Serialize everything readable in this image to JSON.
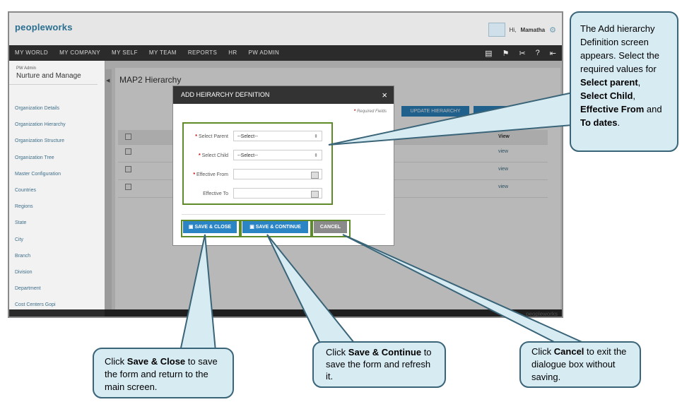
{
  "app": {
    "logo": "peopleworks",
    "user_greeting": "Hi,",
    "user_name": "Mamatha"
  },
  "nav": {
    "items": [
      "MY WORLD",
      "MY COMPANY",
      "MY SELF",
      "MY TEAM",
      "REPORTS",
      "HR",
      "PW ADMIN"
    ],
    "icons": [
      "book-icon",
      "flag-icon",
      "tools-icon",
      "help-icon",
      "exit-icon"
    ]
  },
  "sidebar": {
    "section_small": "PW Admin",
    "section_title": "Nurture and Manage",
    "items": [
      "Organization Details",
      "Organization Hierarchy",
      "Organization Structure",
      "Organization Tree",
      "Master Configuration",
      "Countries",
      "Regions",
      "State",
      "City",
      "Branch",
      "Division",
      "Department",
      "Cost Centers Gopi"
    ]
  },
  "main": {
    "page_title": "MAP2 Hierarchy",
    "update_button": "UPDATE HIERARCHY",
    "table": {
      "header_view": "View",
      "rows": [
        {
          "view": "view"
        },
        {
          "view": "view"
        },
        {
          "view": "view"
        }
      ]
    }
  },
  "footer": {
    "brand": "peopleworks"
  },
  "modal": {
    "title": "ADD HEIRARCHY DEFNITION",
    "close": "×",
    "required_note": "Required Fields",
    "required_mark": "*",
    "fields": {
      "select_parent": {
        "label": "Select Parent",
        "value": "--Select--"
      },
      "select_child": {
        "label": "Select Child",
        "value": "--Select--"
      },
      "effective_from": {
        "label": "Effective From",
        "value": ""
      },
      "effective_to": {
        "label": "Effective To",
        "value": ""
      }
    },
    "buttons": {
      "save_close": "SAVE & CLOSE",
      "save_continue": "SAVE & CONTINUE",
      "cancel": "CANCEL"
    }
  },
  "callouts": {
    "top": {
      "t1": "The Add hierarchy Definition screen appears. Select the required values for ",
      "b1": "Select parent",
      "t2": ", ",
      "b2": "Select Child",
      "t3": ", ",
      "b3": "Effective From",
      "t4": " and ",
      "b4": "To dates",
      "t5": "."
    },
    "save_close": {
      "t1": "Click ",
      "b1": "Save & Close",
      "t2": " to save the form and return to the main screen."
    },
    "save_continue": {
      "t1": "Click ",
      "b1": "Save & Continue",
      "t2": " to save the form and refresh it."
    },
    "cancel": {
      "t1": "Click ",
      "b1": "Cancel",
      "t2": " to exit the dialogue box without saving."
    }
  },
  "colors": {
    "nav_bg": "#2b2b2b",
    "accent_blue": "#2b85c4",
    "highlight_green": "#5e8a2a",
    "callout_fill": "#d7ebf3",
    "callout_border": "#3a6478"
  }
}
